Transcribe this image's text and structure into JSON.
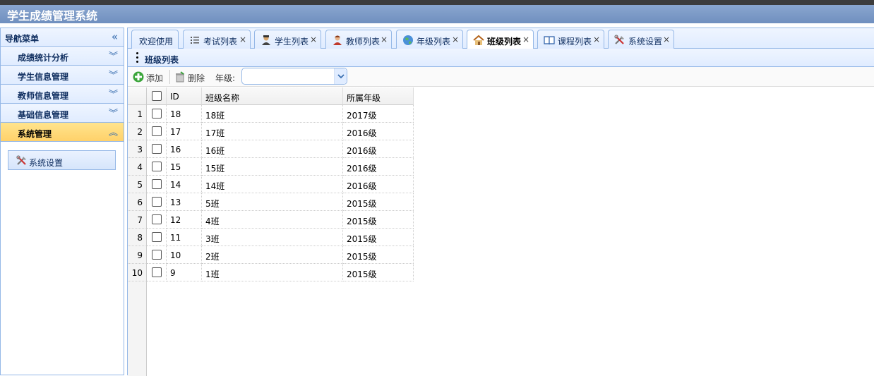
{
  "app": {
    "title": "学生成绩管理系统"
  },
  "nav": {
    "title": "导航菜单",
    "sections": [
      {
        "label": "成绩统计分析"
      },
      {
        "label": "学生信息管理"
      },
      {
        "label": "教师信息管理"
      },
      {
        "label": "基础信息管理"
      },
      {
        "label": "系统管理"
      }
    ],
    "active_section_items": [
      {
        "label": "系统设置",
        "icon": "tools-icon"
      }
    ]
  },
  "tabs": [
    {
      "label": "欢迎使用",
      "icon": "",
      "closable": false
    },
    {
      "label": "考试列表",
      "icon": "list-icon",
      "closable": true
    },
    {
      "label": "学生列表",
      "icon": "student-icon",
      "closable": true
    },
    {
      "label": "教师列表",
      "icon": "teacher-icon",
      "closable": true
    },
    {
      "label": "年级列表",
      "icon": "globe-icon",
      "closable": true
    },
    {
      "label": "班级列表",
      "icon": "house-icon",
      "closable": true,
      "selected": true
    },
    {
      "label": "课程列表",
      "icon": "book-icon",
      "closable": true
    },
    {
      "label": "系统设置",
      "icon": "tools-icon",
      "closable": true
    }
  ],
  "panel": {
    "title": "班级列表"
  },
  "toolbar": {
    "add_label": "添加",
    "delete_label": "删除",
    "grade_label": "年级:",
    "grade_value": ""
  },
  "grid": {
    "columns": [
      "ID",
      "班级名称",
      "所属年级"
    ],
    "rows": [
      {
        "n": "1",
        "id": "18",
        "name": "18班",
        "grade": "2017级"
      },
      {
        "n": "2",
        "id": "17",
        "name": "17班",
        "grade": "2016级"
      },
      {
        "n": "3",
        "id": "16",
        "name": "16班",
        "grade": "2016级"
      },
      {
        "n": "4",
        "id": "15",
        "name": "15班",
        "grade": "2016级"
      },
      {
        "n": "5",
        "id": "14",
        "name": "14班",
        "grade": "2016级"
      },
      {
        "n": "6",
        "id": "13",
        "name": "5班",
        "grade": "2015级"
      },
      {
        "n": "7",
        "id": "12",
        "name": "4班",
        "grade": "2015级"
      },
      {
        "n": "8",
        "id": "11",
        "name": "3班",
        "grade": "2015级"
      },
      {
        "n": "9",
        "id": "10",
        "name": "2班",
        "grade": "2015级"
      },
      {
        "n": "10",
        "id": "9",
        "name": "1班",
        "grade": "2015级"
      }
    ]
  }
}
